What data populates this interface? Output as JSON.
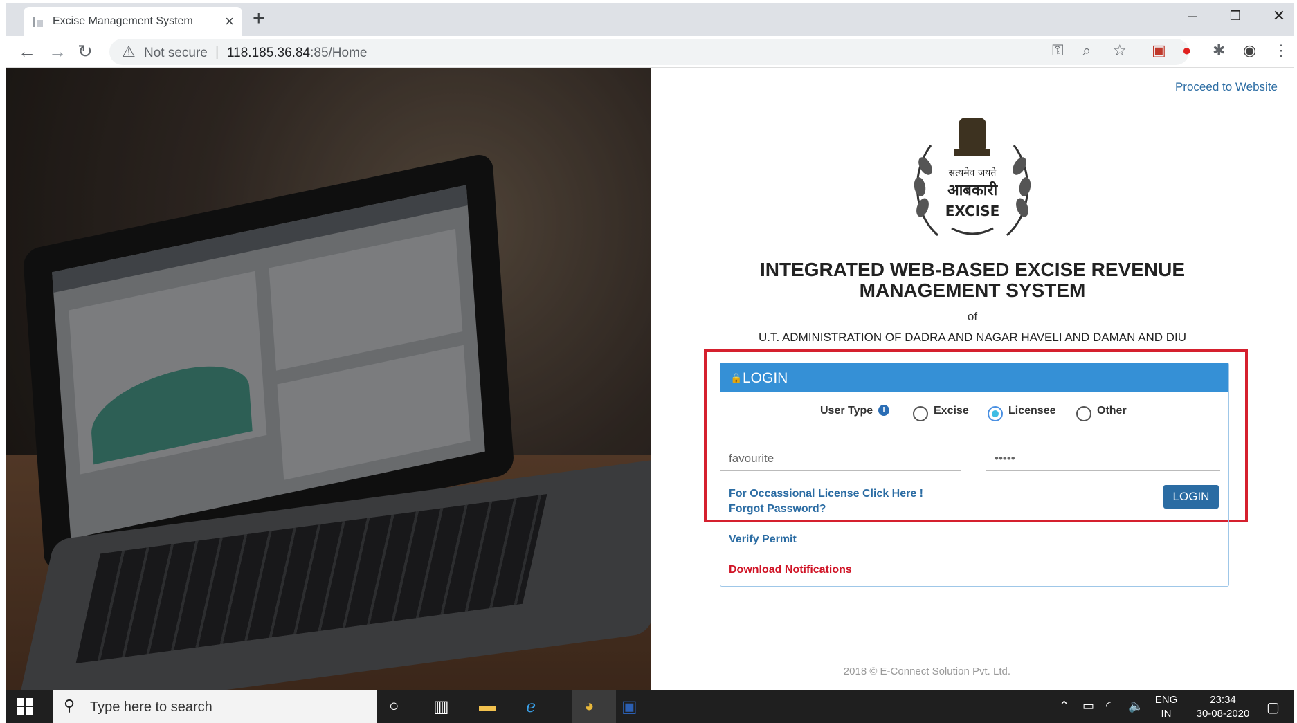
{
  "browser": {
    "tab_title": "Excise Management System",
    "tab_close": "×",
    "new_tab": "+",
    "minimize": "–",
    "restore": "❐",
    "close": "✕",
    "not_secure": "Not secure",
    "url_host": "118.185.36.84",
    "url_rest": ":85/Home"
  },
  "page": {
    "proceed_link": "Proceed to Website",
    "emblem_motto": "सत्यमेव जयते",
    "emblem_hindi": "आबकारी",
    "emblem_english": "EXCISE",
    "title_line1": "INTEGRATED WEB-BASED EXCISE REVENUE",
    "title_line2": "MANAGEMENT SYSTEM",
    "of_text": "of",
    "org_text": "U.T. ADMINISTRATION OF DADRA AND NAGAR HAVELI AND DAMAN AND DIU"
  },
  "login": {
    "header": "LOGIN",
    "user_type_label": "User Type",
    "options": [
      "Excise",
      "Licensee",
      "Other"
    ],
    "selected_option": "Licensee",
    "username_value": "favourite",
    "password_value": "•••••",
    "occasional_link": "For Occassional License Click Here !",
    "forgot_link": "Forgot Password?",
    "login_button": "LOGIN",
    "verify_link": "Verify Permit",
    "download_link": "Download Notifications"
  },
  "footer": "2018 © E-Connect Solution Pvt. Ltd.",
  "taskbar": {
    "search_placeholder": "Type here to search",
    "lang_line1": "ENG",
    "lang_line2": "IN",
    "time": "23:34",
    "date": "30-08-2020"
  },
  "colors": {
    "login_header": "#3590d6",
    "highlight_border": "#d5202e",
    "link_blue": "#2b6ca3",
    "link_red": "#d01426"
  }
}
